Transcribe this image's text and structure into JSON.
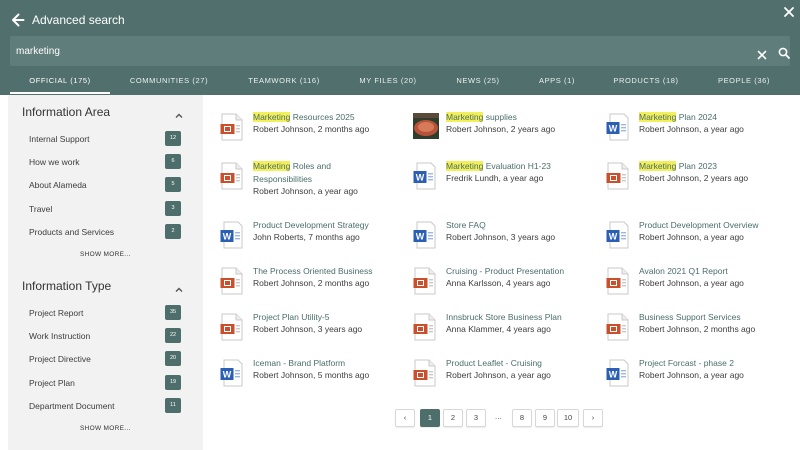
{
  "header": {
    "title": "Advanced search",
    "search_value": "marketing"
  },
  "tabs": [
    {
      "label": "OFFICIAL (175)",
      "active": true
    },
    {
      "label": "COMMUNITIES (27)"
    },
    {
      "label": "TEAMWORK (116)"
    },
    {
      "label": "MY FILES (20)"
    },
    {
      "label": "NEWS (25)"
    },
    {
      "label": "APPS (1)"
    },
    {
      "label": "PRODUCTS (18)"
    },
    {
      "label": "PEOPLE (36)"
    }
  ],
  "sidebar": {
    "sections": [
      {
        "title": "Information Area",
        "items": [
          {
            "label": "Internal Support",
            "count": "12"
          },
          {
            "label": "How we work",
            "count": "6"
          },
          {
            "label": "About Alameda",
            "count": "5"
          },
          {
            "label": "Travel",
            "count": "3"
          },
          {
            "label": "Products and Services",
            "count": "2"
          }
        ],
        "show_more": "SHOW MORE..."
      },
      {
        "title": "Information Type",
        "items": [
          {
            "label": "Project Report",
            "count": "35"
          },
          {
            "label": "Work Instruction",
            "count": "22"
          },
          {
            "label": "Project Directive",
            "count": "20"
          },
          {
            "label": "Project Plan",
            "count": "19"
          },
          {
            "label": "Department Document",
            "count": "11"
          }
        ],
        "show_more": "SHOW MORE..."
      }
    ]
  },
  "results": [
    {
      "hl": "Marketing",
      "rest": " Resources 2025",
      "meta": "Robert Johnson, 2 months ago",
      "icon": "ppt-icon"
    },
    {
      "hl": "Marketing",
      "rest": " supplies",
      "meta": "Robert Johnson, 2 years ago",
      "icon": "image-thumbnail"
    },
    {
      "hl": "Marketing",
      "rest": " Plan 2024",
      "meta": "Robert Johnson, a year ago",
      "icon": "word-icon"
    },
    {
      "hl": "Marketing",
      "rest": " Roles and Responsibilities",
      "meta": "Robert Johnson, a year ago",
      "icon": "ppt-icon"
    },
    {
      "hl": "Marketing",
      "rest": " Evaluation H1-23",
      "meta": "Fredrik Lundh, a year ago",
      "icon": "word-icon"
    },
    {
      "hl": "Marketing",
      "rest": " Plan 2023",
      "meta": "Robert Johnson, 2 years ago",
      "icon": "ppt-icon"
    },
    {
      "hl": "",
      "rest": "Product Development Strategy",
      "meta": "John Roberts, 7 months ago",
      "icon": "word-icon"
    },
    {
      "hl": "",
      "rest": "Store FAQ",
      "meta": "Robert Johnson, 3 years ago",
      "icon": "word-icon"
    },
    {
      "hl": "",
      "rest": "Product Development Overview",
      "meta": "Robert Johnson, a year ago",
      "icon": "word-icon"
    },
    {
      "hl": "",
      "rest": "The Process Oriented Business",
      "meta": "Robert Johnson, 2 months ago",
      "icon": "ppt-icon"
    },
    {
      "hl": "",
      "rest": "Cruising - Product Presentation",
      "meta": "Anna Karlsson, 4 years ago",
      "icon": "ppt-icon"
    },
    {
      "hl": "",
      "rest": "Avalon 2021 Q1 Report",
      "meta": "Robert Johnson, a year ago",
      "icon": "ppt-icon"
    },
    {
      "hl": "",
      "rest": "Project Plan Utility-5",
      "meta": "Robert Johnson, 3 years ago",
      "icon": "ppt-icon"
    },
    {
      "hl": "",
      "rest": "Innsbruck Store Business Plan",
      "meta": "Anna Klammer, 4 years ago",
      "icon": "ppt-icon"
    },
    {
      "hl": "",
      "rest": "Business Support Services",
      "meta": "Robert Johnson, 2 months ago",
      "icon": "ppt-icon"
    },
    {
      "hl": "",
      "rest": "Iceman - Brand Platform",
      "meta": "Robert Johnson, 5 months ago",
      "icon": "word-icon"
    },
    {
      "hl": "",
      "rest": "Product Leaflet - Cruising",
      "meta": "Robert Johnson, a year ago",
      "icon": "ppt-icon"
    },
    {
      "hl": "",
      "rest": "Project Forcast - phase 2",
      "meta": "Robert Johnson, a year ago",
      "icon": "word-icon"
    }
  ],
  "pagination": {
    "prev": "‹",
    "pages": [
      "1",
      "2",
      "3",
      "8",
      "9",
      "10"
    ],
    "ellipsis": "...",
    "next": "›",
    "active": "1"
  },
  "colors": {
    "header": "#51706d",
    "accent": "#4d6e6b",
    "highlight": "#f3ef5a",
    "link": "#4a6e69"
  }
}
